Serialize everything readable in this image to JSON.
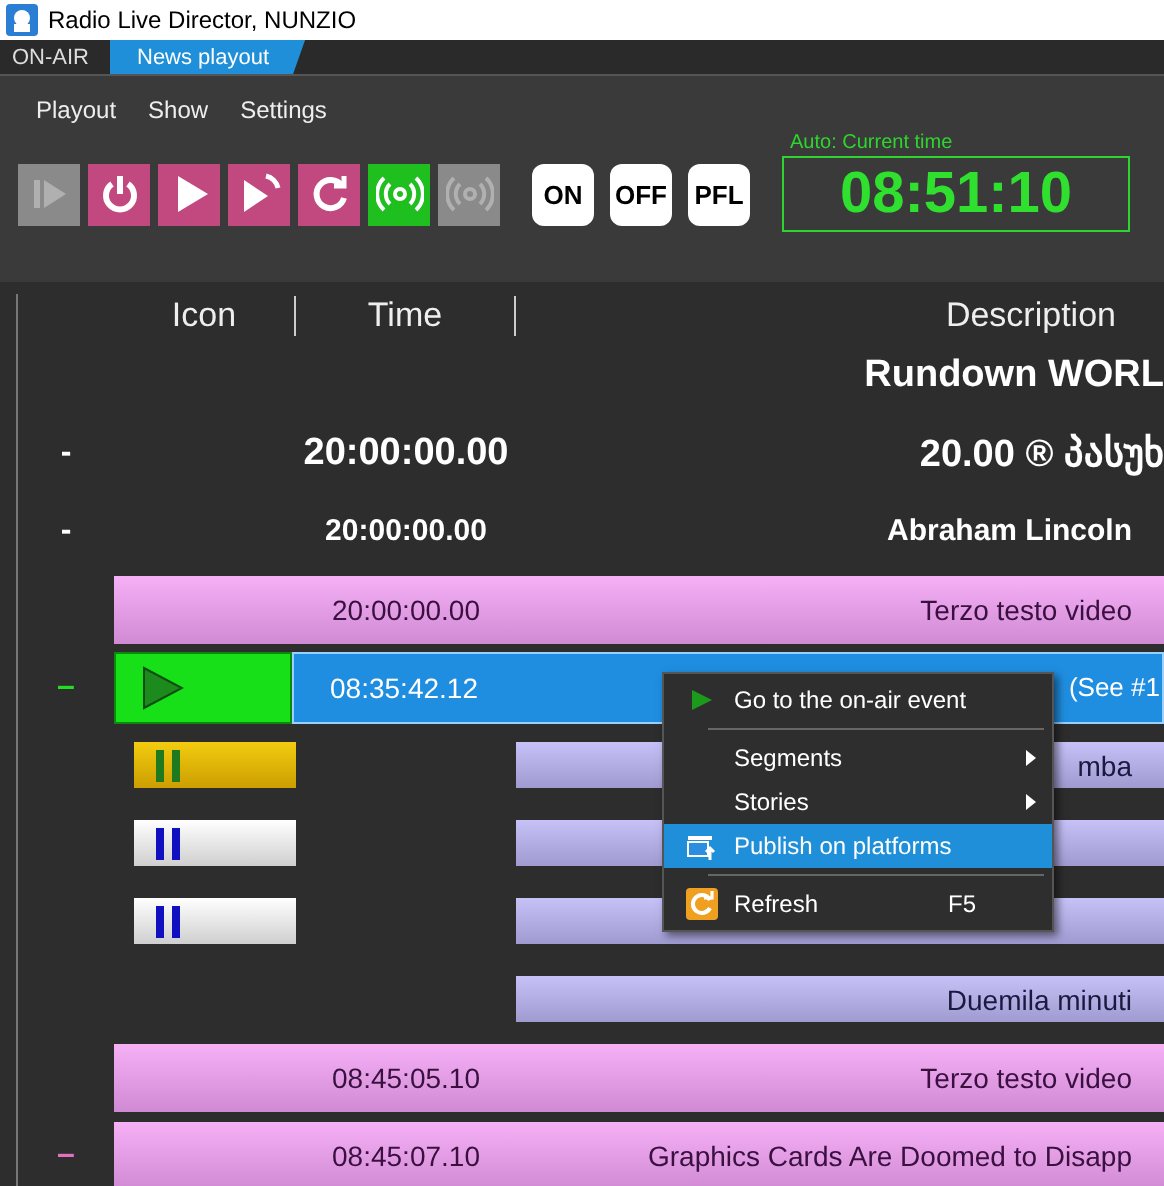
{
  "window": {
    "title": "Radio Live Director, NUNZIO"
  },
  "tabs": [
    {
      "label": "ON-AIR",
      "selected": false
    },
    {
      "label": "News playout",
      "selected": true
    }
  ],
  "menu": [
    "Playout",
    "Show",
    "Settings"
  ],
  "toolbar": [
    {
      "kind": "skip",
      "disabled": true,
      "on": false
    },
    {
      "kind": "power",
      "disabled": false,
      "on": false
    },
    {
      "kind": "play",
      "disabled": false,
      "on": false
    },
    {
      "kind": "next",
      "disabled": false,
      "on": false
    },
    {
      "kind": "loop",
      "disabled": false,
      "on": false
    },
    {
      "kind": "broadcast",
      "disabled": false,
      "on": true
    },
    {
      "kind": "broadcast",
      "disabled": true,
      "on": false
    }
  ],
  "audio_buttons": [
    "ON",
    "OFF",
    "PFL"
  ],
  "clock": {
    "label": "Auto: Current time",
    "time": "08:51:10"
  },
  "columns": [
    "Icon",
    "Time",
    "Description"
  ],
  "rows": [
    {
      "kind": "title",
      "description": "Rundown WORL"
    },
    {
      "kind": "group",
      "marker": "-",
      "time": "20:00:00.00",
      "description": "20.00 ® პასუხ",
      "large": true
    },
    {
      "kind": "group",
      "marker": "-",
      "time": "20:00:00.00",
      "description": "Abraham Lincoln",
      "large": false
    },
    {
      "kind": "item",
      "time": "20:00:00.00",
      "description": "Terzo testo video"
    },
    {
      "kind": "onair",
      "marker": "–",
      "time": "08:35:42.12",
      "description": "(See #1"
    },
    {
      "kind": "segment",
      "cued": true,
      "description": "mba"
    },
    {
      "kind": "segment",
      "cued": false
    },
    {
      "kind": "segment",
      "cued": false
    },
    {
      "kind": "segment_text",
      "description": "Duemila minuti"
    },
    {
      "kind": "item",
      "time": "08:45:05.10",
      "description": "Terzo testo video"
    },
    {
      "kind": "item",
      "marker": "–",
      "time": "08:45:07.10",
      "description": "Graphics Cards Are Doomed to Disapp"
    }
  ],
  "context_menu": [
    {
      "kind": "goto",
      "label": "Go to the on-air event",
      "selected": false
    },
    {
      "kind": "separator"
    },
    {
      "kind": "submenu",
      "label": "Segments",
      "selected": false
    },
    {
      "kind": "submenu",
      "label": "Stories",
      "selected": false
    },
    {
      "kind": "publish",
      "label": "Publish on platforms",
      "selected": true
    },
    {
      "kind": "separator"
    },
    {
      "kind": "refresh",
      "label": "Refresh",
      "shortcut": "F5",
      "selected": false
    }
  ]
}
